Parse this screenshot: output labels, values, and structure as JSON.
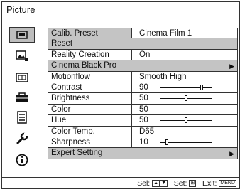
{
  "window": {
    "title": "Picture"
  },
  "sidebar": {
    "icons": [
      {
        "name": "picture-icon",
        "selected": true
      },
      {
        "name": "picture-settings-icon",
        "selected": false
      },
      {
        "name": "screen-icon",
        "selected": false
      },
      {
        "name": "setup-icon",
        "selected": false
      },
      {
        "name": "function-icon",
        "selected": false
      },
      {
        "name": "installation-icon",
        "selected": false
      },
      {
        "name": "information-icon",
        "selected": false
      }
    ]
  },
  "menu": {
    "rows": [
      {
        "label": "Calib. Preset",
        "value": "Cinema Film 1",
        "type": "value"
      },
      {
        "label": "Reset",
        "value": "",
        "type": "full"
      },
      {
        "label": "Reality Creation",
        "value": "On",
        "type": "value"
      },
      {
        "label": "Cinema Black Pro",
        "value": "",
        "type": "submenu"
      },
      {
        "label": "Motionflow",
        "value": "Smooth High",
        "type": "value"
      },
      {
        "label": "Contrast",
        "value": "90",
        "type": "slider",
        "level": 0.8
      },
      {
        "label": "Brightness",
        "value": "50",
        "type": "slider",
        "level": 0.5
      },
      {
        "label": "Color",
        "value": "50",
        "type": "slider",
        "level": 0.5
      },
      {
        "label": "Hue",
        "value": "50",
        "type": "slider",
        "level": 0.5
      },
      {
        "label": "Color Temp.",
        "value": "D65",
        "type": "value"
      },
      {
        "label": "Sharpness",
        "value": "10",
        "type": "slider",
        "level": 0.12
      },
      {
        "label": "Expert Setting",
        "value": "",
        "type": "submenu"
      }
    ]
  },
  "footer": {
    "sel_label": "Sel:",
    "set_label": "Set:",
    "exit_label": "Exit:",
    "menu_key": "MENU"
  },
  "colors": {
    "highlight": "#c4c4c4",
    "border": "#333333"
  }
}
